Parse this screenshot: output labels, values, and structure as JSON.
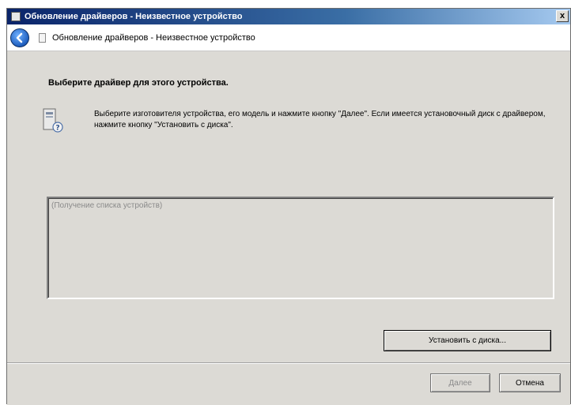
{
  "window": {
    "title": "Обновление драйверов - Неизвестное устройство",
    "close_label": "x"
  },
  "navbar": {
    "breadcrumb": "Обновление драйверов - Неизвестное устройство"
  },
  "main": {
    "heading": "Выберите драйвер для этого устройства.",
    "description": "Выберите изготовителя устройства, его модель и нажмите кнопку \"Далее\". Если имеется установочный диск с драйвером, нажмите кнопку \"Установить с диска\".",
    "list_placeholder": "(Получение списка устройств)",
    "have_disk_label": "Установить с диска..."
  },
  "footer": {
    "next_label": "Далее",
    "cancel_label": "Отмена"
  },
  "icons": {
    "title": "app-icon",
    "back": "back-arrow-icon",
    "nav": "document-icon",
    "device": "unknown-device-icon"
  }
}
